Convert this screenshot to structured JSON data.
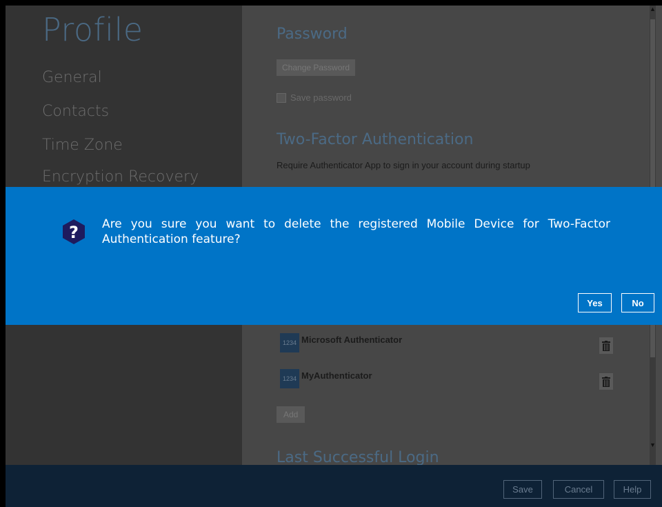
{
  "sidebar": {
    "title": "Profile",
    "items": [
      {
        "label": "General"
      },
      {
        "label": "Contacts"
      },
      {
        "label": "Time Zone"
      },
      {
        "label": "Encryption Recovery"
      }
    ]
  },
  "main": {
    "password_heading": "Password",
    "change_password_label": "Change Password",
    "save_password_label": "Save password",
    "tfa_heading": "Two-Factor Authentication",
    "tfa_description": "Require Authenticator App to sign in your account during startup",
    "authenticators": [
      {
        "badge": "1234",
        "name": "Microsoft Authenticator"
      },
      {
        "badge": "1234",
        "name": "MyAuthenticator"
      }
    ],
    "add_label": "Add",
    "last_login_heading": "Last Successful Login"
  },
  "dialog": {
    "message": "Are you sure you want to delete the registered Mobile Device for Two-Factor Authentication feature?",
    "yes_label": "Yes",
    "no_label": "No",
    "accent_color": "#0074c7"
  },
  "footer": {
    "save_label": "Save",
    "cancel_label": "Cancel",
    "help_label": "Help"
  }
}
